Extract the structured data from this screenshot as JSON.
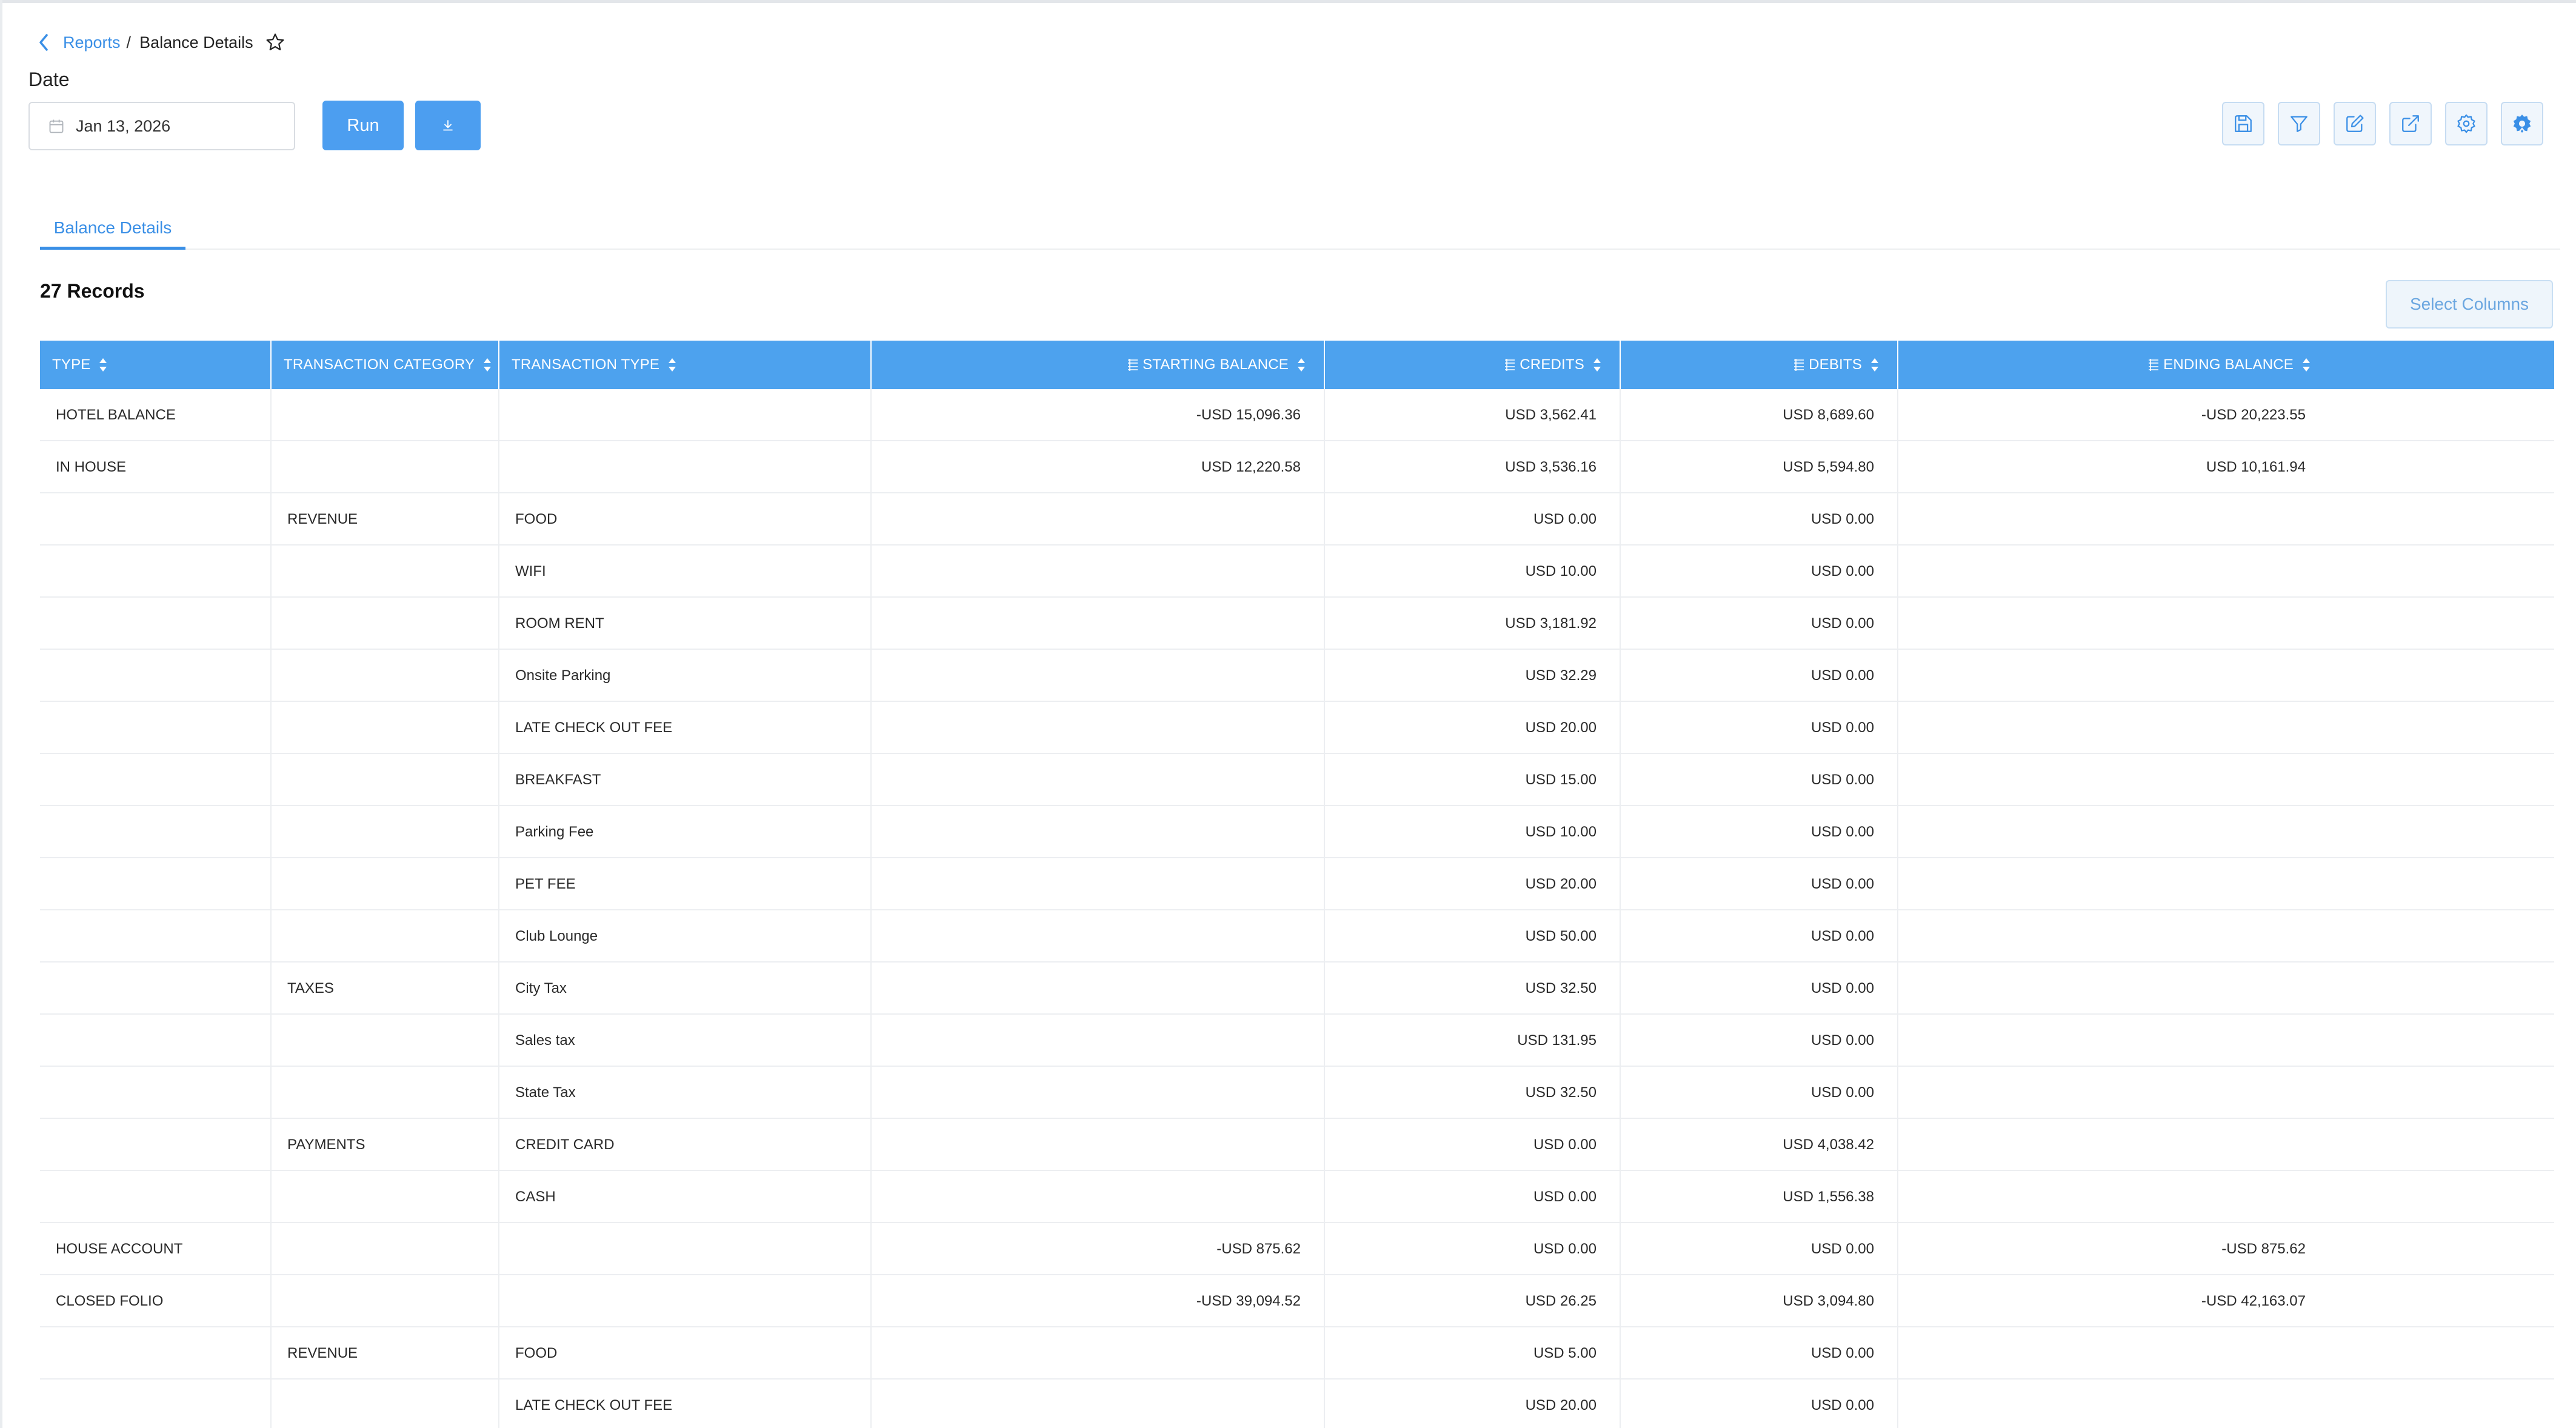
{
  "breadcrumb": {
    "parent": "Reports",
    "separator": "/",
    "current": "Balance Details"
  },
  "date": {
    "label": "Date",
    "value": "Jan 13, 2026"
  },
  "buttons": {
    "run": "Run"
  },
  "toolbar": [
    "save-icon",
    "filter-icon",
    "edit-icon",
    "export-icon",
    "settings-icon",
    "advanced-settings-icon"
  ],
  "tabs": [
    {
      "label": "Balance Details",
      "active": true
    }
  ],
  "records": "27 Records",
  "select_columns": "Select Columns",
  "colors": {
    "accent": "#4da2ee",
    "link": "#3a8fe6"
  },
  "table": {
    "columns": [
      "TYPE",
      "TRANSACTION CATEGORY",
      "TRANSACTION TYPE",
      "STARTING BALANCE",
      "CREDITS",
      "DEBITS",
      "ENDING BALANCE"
    ],
    "rows": [
      [
        "HOTEL BALANCE",
        "",
        "",
        "-USD 15,096.36",
        "USD 3,562.41",
        "USD 8,689.60",
        "-USD 20,223.55"
      ],
      [
        "IN HOUSE",
        "",
        "",
        "USD 12,220.58",
        "USD 3,536.16",
        "USD 5,594.80",
        "USD 10,161.94"
      ],
      [
        "",
        "REVENUE",
        "FOOD",
        "",
        "USD 0.00",
        "USD 0.00",
        ""
      ],
      [
        "",
        "",
        "WIFI",
        "",
        "USD 10.00",
        "USD 0.00",
        ""
      ],
      [
        "",
        "",
        "ROOM RENT",
        "",
        "USD 3,181.92",
        "USD 0.00",
        ""
      ],
      [
        "",
        "",
        "Onsite Parking",
        "",
        "USD 32.29",
        "USD 0.00",
        ""
      ],
      [
        "",
        "",
        "LATE CHECK OUT FEE",
        "",
        "USD 20.00",
        "USD 0.00",
        ""
      ],
      [
        "",
        "",
        "BREAKFAST",
        "",
        "USD 15.00",
        "USD 0.00",
        ""
      ],
      [
        "",
        "",
        "Parking Fee",
        "",
        "USD 10.00",
        "USD 0.00",
        ""
      ],
      [
        "",
        "",
        "PET FEE",
        "",
        "USD 20.00",
        "USD 0.00",
        ""
      ],
      [
        "",
        "",
        "Club Lounge",
        "",
        "USD 50.00",
        "USD 0.00",
        ""
      ],
      [
        "",
        "TAXES",
        "City Tax",
        "",
        "USD 32.50",
        "USD 0.00",
        ""
      ],
      [
        "",
        "",
        "Sales tax",
        "",
        "USD 131.95",
        "USD 0.00",
        ""
      ],
      [
        "",
        "",
        "State Tax",
        "",
        "USD 32.50",
        "USD 0.00",
        ""
      ],
      [
        "",
        "PAYMENTS",
        "CREDIT CARD",
        "",
        "USD 0.00",
        "USD 4,038.42",
        ""
      ],
      [
        "",
        "",
        "CASH",
        "",
        "USD 0.00",
        "USD 1,556.38",
        ""
      ],
      [
        "HOUSE ACCOUNT",
        "",
        "",
        "-USD 875.62",
        "USD 0.00",
        "USD 0.00",
        "-USD 875.62"
      ],
      [
        "CLOSED FOLIO",
        "",
        "",
        "-USD 39,094.52",
        "USD 26.25",
        "USD 3,094.80",
        "-USD 42,163.07"
      ],
      [
        "",
        "REVENUE",
        "FOOD",
        "",
        "USD 5.00",
        "USD 0.00",
        ""
      ],
      [
        "",
        "",
        "LATE CHECK OUT FEE",
        "",
        "USD 20.00",
        "USD 0.00",
        ""
      ]
    ]
  }
}
